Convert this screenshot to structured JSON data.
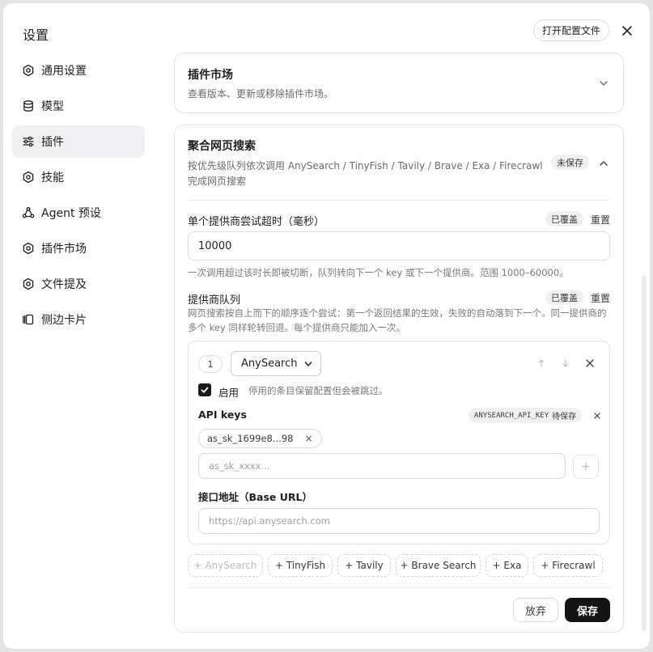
{
  "dialog": {
    "title": "设置",
    "open_config_label": "打开配置文件"
  },
  "sidebar": {
    "items": [
      {
        "label": "通用设置",
        "icon": "gear-icon"
      },
      {
        "label": "模型",
        "icon": "database-icon"
      },
      {
        "label": "插件",
        "icon": "sliders-icon",
        "active": true
      },
      {
        "label": "技能",
        "icon": "gear-icon"
      },
      {
        "label": "Agent 预设",
        "icon": "agent-icon"
      },
      {
        "label": "插件市场",
        "icon": "gear-icon"
      },
      {
        "label": "文件提及",
        "icon": "gear-icon"
      },
      {
        "label": "侧边卡片",
        "icon": "cards-icon"
      }
    ]
  },
  "plugin_market": {
    "title": "插件市场",
    "description": "查看版本、更新或移除插件市场。"
  },
  "web_search": {
    "title": "聚合网页搜索",
    "description": "按优先级队列依次调用 AnySearch / TinyFish / Tavily / Brave / Exa / Firecrawl 完成网页搜索",
    "unsaved_badge": "未保存",
    "timeout": {
      "label": "单个提供商尝试超时（毫秒）",
      "override_badge": "已覆盖",
      "reset_label": "重置",
      "value": "10000",
      "hint": "一次调用超过该时长即被切断，队列转向下一个 key 或下一个提供商。范围 1000–60000。"
    },
    "queue": {
      "label": "提供商队列",
      "override_badge": "已覆盖",
      "reset_label": "重置",
      "hint": "网页搜索按自上而下的顺序逐个尝试：第一个返回结果的生效，失败的自动落到下一个。同一提供商的多个 key 同样轮转回退。每个提供商只能加入一次。"
    },
    "provider": {
      "index": "1",
      "selected": "AnySearch",
      "enabled_label": "启用",
      "enabled_hint": "停用的条目保留配置但会被跳过。",
      "api_keys_label": "API keys",
      "env_badge_code": "ANYSEARCH_API_KEY",
      "env_badge_text": "待保存",
      "key_chip": "as_sk_1699e8...98",
      "key_placeholder": "as_sk_xxxx...",
      "base_url_label": "接口地址（Base URL）",
      "base_url_placeholder": "https://api.anysearch.com"
    },
    "add_buttons": [
      "+ AnySearch",
      "+ TinyFish",
      "+ Tavily",
      "+ Brave Search",
      "+ Exa",
      "+ Firecrawl"
    ],
    "cancel_label": "放弃",
    "save_label": "保存"
  }
}
